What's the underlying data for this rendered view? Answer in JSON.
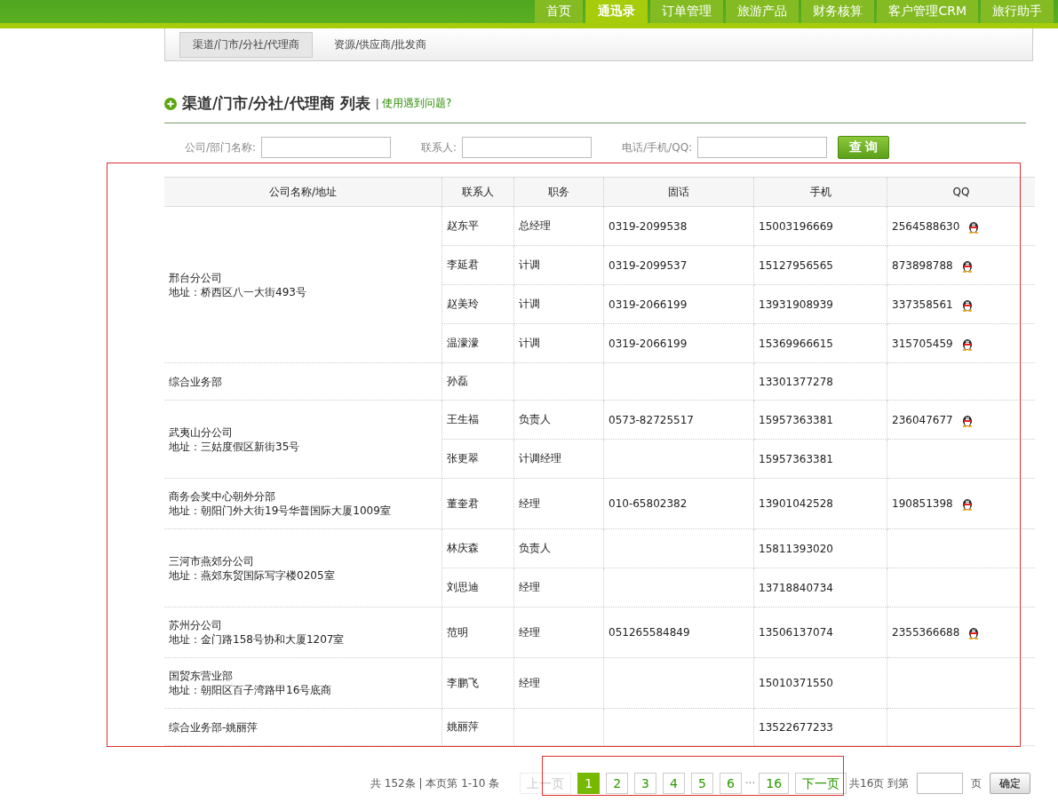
{
  "nav": {
    "items": [
      {
        "label": "首页",
        "selected": false
      },
      {
        "label": "通迅录",
        "selected": true
      },
      {
        "label": "订单管理",
        "selected": false
      },
      {
        "label": "旅游产品",
        "selected": false
      },
      {
        "label": "财务核算",
        "selected": false
      },
      {
        "label": "客户管理CRM",
        "selected": false
      },
      {
        "label": "旅行助手",
        "selected": false
      }
    ]
  },
  "subtabs": [
    {
      "label": "渠道/门市/分社/代理商",
      "selected": true
    },
    {
      "label": "资源/供应商/批发商",
      "selected": false
    }
  ],
  "heading": {
    "title": "渠道/门市/分社/代理商 列表",
    "separator": "|",
    "help_link": "使用遇到问题?"
  },
  "search": {
    "fields": [
      {
        "label": "公司/部门名称:"
      },
      {
        "label": "联系人:"
      },
      {
        "label": "电话/手机/QQ:"
      }
    ],
    "button": "查 询"
  },
  "table": {
    "columns": [
      "公司名称/地址",
      "联系人",
      "职务",
      "固话",
      "手机",
      "QQ"
    ],
    "groups": [
      {
        "name": "邢台分公司",
        "address": "地址：桥西区八一大街493号",
        "contacts": [
          {
            "name": "赵东平",
            "title": "总经理",
            "phone": "0319-2099538",
            "mobile": "15003196669",
            "qq": "2564588630"
          },
          {
            "name": "李延君",
            "title": "计调",
            "phone": "0319-2099537",
            "mobile": "15127956565",
            "qq": "873898788"
          },
          {
            "name": "赵美玲",
            "title": "计调",
            "phone": "0319-2066199",
            "mobile": "13931908939",
            "qq": "337358561"
          },
          {
            "name": "温濛濛",
            "title": "计调",
            "phone": "0319-2066199",
            "mobile": "15369966615",
            "qq": "315705459"
          }
        ]
      },
      {
        "name": "综合业务部",
        "contacts": [
          {
            "name": "孙磊",
            "mobile": "13301377278"
          }
        ]
      },
      {
        "name": "武夷山分公司",
        "address": "地址：三姑度假区新街35号",
        "contacts": [
          {
            "name": "王生福",
            "title": "负责人",
            "phone": "0573-82725517",
            "mobile": "15957363381",
            "qq": "236047677"
          },
          {
            "name": "张更翠",
            "title": "计调经理",
            "mobile": "15957363381"
          }
        ]
      },
      {
        "name": "商务会奖中心朝外分部",
        "address": "地址：朝阳门外大街19号华普国际大厦1009室",
        "contacts": [
          {
            "name": "董奎君",
            "title": "经理",
            "phone": "010-65802382",
            "mobile": "13901042528",
            "qq": "190851398"
          }
        ]
      },
      {
        "name": "三河市燕郊分公司",
        "address": "地址：燕郊东贸国际写字楼0205室",
        "contacts": [
          {
            "name": "林庆森",
            "title": "负责人",
            "mobile": "15811393020"
          },
          {
            "name": "刘思迪",
            "title": "经理",
            "mobile": "13718840734"
          }
        ]
      },
      {
        "name": "苏州分公司",
        "address": "地址：金门路158号协和大厦1207室",
        "contacts": [
          {
            "name": "范明",
            "title": "经理",
            "phone": "051265584849",
            "mobile": "13506137074",
            "qq": "2355366688"
          }
        ]
      },
      {
        "name": "国贸东营业部",
        "address": "地址：朝阳区百子湾路甲16号底商",
        "contacts": [
          {
            "name": "李鹏飞",
            "title": "经理",
            "mobile": "15010371550"
          }
        ]
      },
      {
        "name": "综合业务部-姚丽萍",
        "contacts": [
          {
            "name": "姚丽萍",
            "mobile": "13522677233"
          }
        ]
      }
    ]
  },
  "pagination": {
    "summary": "共 152条 | 本页第 1-10 条",
    "prev": {
      "label": "上一页",
      "disabled": true
    },
    "pages": [
      {
        "label": "1",
        "selected": true
      },
      {
        "label": "2",
        "selected": false
      },
      {
        "label": "3",
        "selected": false
      },
      {
        "label": "4",
        "selected": false
      },
      {
        "label": "5",
        "selected": false
      },
      {
        "label": "6",
        "selected": false
      },
      {
        "kind": "ellipsis",
        "label": "···"
      },
      {
        "label": "16",
        "selected": false
      }
    ],
    "next": {
      "label": "下一页",
      "disabled": false
    },
    "total": "共16页 到第",
    "unit": "页",
    "go": "确定"
  }
}
